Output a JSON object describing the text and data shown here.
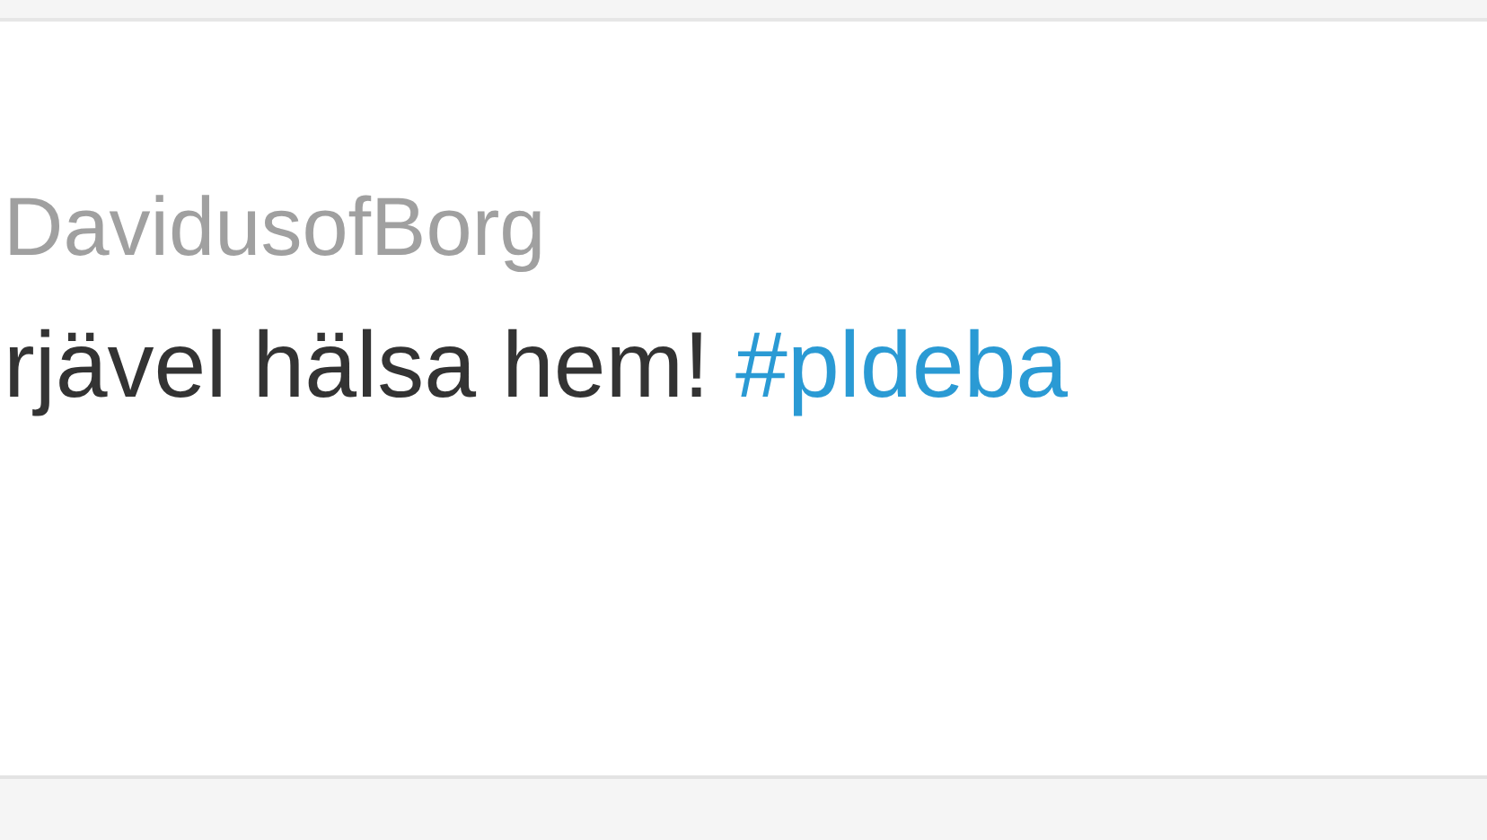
{
  "tweet": {
    "username": "DavidusofBorg",
    "text": "rjävel hälsa hem! ",
    "hashtag": "#pldeba"
  }
}
